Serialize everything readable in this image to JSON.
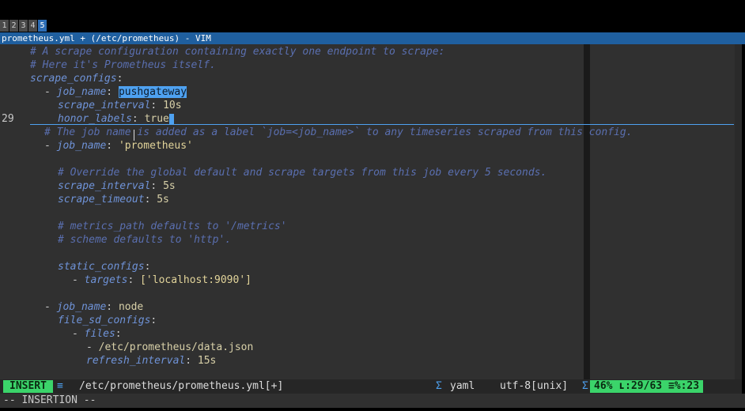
{
  "workspaces": [
    "1",
    "2",
    "3",
    "4",
    "5"
  ],
  "active_workspace": "5",
  "title": "prometheus.yml + (/etc/prometheus) - VIM",
  "line_number": "29",
  "lines": {
    "l1": "# A scrape configuration containing exactly one endpoint to scrape:",
    "l2": "# Here it's Prometheus itself.",
    "l3_key": "scrape_configs",
    "l4_key": "job_name",
    "l4_val": "pushgateway",
    "l5_key": "scrape_interval",
    "l5_val": "10s",
    "l6_key": "honor_labels",
    "l6_val": "true",
    "l7": "# The job name is added as a label `job=<job_name>` to any timeseries scraped from this config.",
    "l8_key": "job_name",
    "l8_val": "'prometheus'",
    "l10": "# Override the global default and scrape targets from this job every 5 seconds.",
    "l11_key": "scrape_interval",
    "l11_val": "5s",
    "l12_key": "scrape_timeout",
    "l12_val": "5s",
    "l14": "# metrics_path defaults to '/metrics'",
    "l15": "# scheme defaults to 'http'.",
    "l17_key": "static_configs",
    "l18_key": "targets",
    "l18_val": "['localhost:9090']",
    "l20_key": "job_name",
    "l20_val": "node",
    "l21_key": "file_sd_configs",
    "l22_key": "files",
    "l23_val": "/etc/prometheus/data.json",
    "l24_key": "refresh_interval",
    "l24_val": "15s"
  },
  "status": {
    "mode": "INSERT",
    "mode_icon": "≡",
    "filepath": "/etc/prometheus/prometheus.yml[+]",
    "filetype_icon": "Σ",
    "filetype": "yaml",
    "encoding": "utf-8[unix]",
    "percent": "46%",
    "position": "ʟ:29/63",
    "column": "≡%:23"
  },
  "cmdline": "-- INSERTION --"
}
